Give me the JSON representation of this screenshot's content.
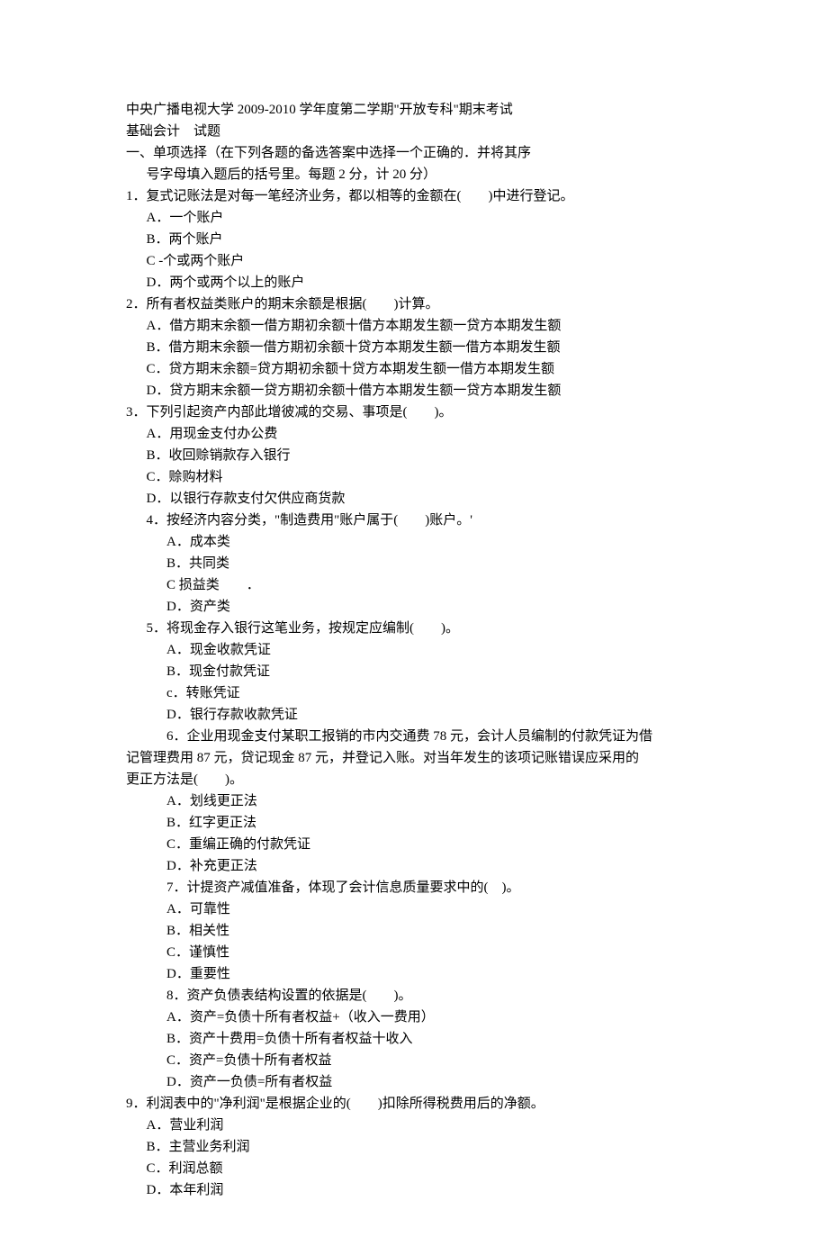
{
  "header": {
    "title_line1": "中央广播电视大学 2009-2010 学年度第二学期\"开放专科\"期末考试",
    "title_line2": "基础会计　试题"
  },
  "section1": {
    "heading_line1": "一、单项选择（在下列各题的备选答案中选择一个正确的．并将其序",
    "heading_line2": "号字母填入题后的括号里。每题 2 分，计 20 分）"
  },
  "q1": {
    "stem": "1．复式记账法是对每一笔经济业务，都以相等的金额在(　　)中进行登记。",
    "a": "A．一个账户",
    "b": "B．两个账户",
    "c": "C -个或两个账户",
    "d": "D．两个或两个以上的账户"
  },
  "q2": {
    "stem": "2．所有者权益类账户的期末余额是根据(　　)计算。",
    "a": "A．借方期末余额一借方期初余额十借方本期发生额一贷方本期发生额",
    "b": "B．借方期末余额一借方期初余额十贷方本期发生额一借方本期发生额",
    "c": "C．贷方期末余额=贷方期初余额十贷方本期发生额一借方本期发生额",
    "d": "D．贷方期末余额一贷方期初余额十借方本期发生额一贷方本期发生额"
  },
  "q3": {
    "stem": "3．下列引起资产内部此增彼减的交易、事项是(　　)。",
    "a": "A．用现金支付办公费",
    "b": "B．收回赊销款存入银行",
    "c": "C．赊购材料",
    "d": "D．以银行存款支付欠供应商货款"
  },
  "q4": {
    "stem": "4．按经济内容分类，\"制造费用\"账户属于(　　)账户。'",
    "a": "A．成本类",
    "b": "B．共同类",
    "c": "C 损益类　　．",
    "d": "D．资产类"
  },
  "q5": {
    "stem": "5．将现金存入银行这笔业务，按规定应编制(　　)。",
    "a": "A．现金收款凭证",
    "b": "B．现金付款凭证",
    "c": "c．转账凭证",
    "d": "D．银行存款收款凭证"
  },
  "q6": {
    "stem_line1": "6．企业用现金支付某职工报销的市内交通费 78 元，会计人员编制的付款凭证为借",
    "stem_line2": "记管理费用 87 元，贷记现金 87 元，并登记入账。对当年发生的该项记账错误应采用的",
    "stem_line3": "更正方法是(　　)。",
    "a": "A．划线更正法",
    "b": "B．红字更正法",
    "c": "C．重编正确的付款凭证",
    "d": "D．补充更正法"
  },
  "q7": {
    "stem": "7．计提资产减值准备，体现了会计信息质量要求中的(　)。",
    "a": "A．可靠性",
    "b": "B．相关性",
    "c": "C．谨慎性",
    "d": "D．重要性"
  },
  "q8": {
    "stem": "8．资产负债表结构设置的依据是(　　)。",
    "a": "A．资产=负债十所有者权益+（收入一费用）",
    "b": "B．资产十费用=负债十所有者权益十收入",
    "c": "C．资产=负债十所有者权益",
    "d": "D．资产一负债=所有者权益"
  },
  "q9": {
    "stem": "9．利润表中的\"净利润\"是根据企业的(　　)扣除所得税费用后的净额。",
    "a": "A．营业利润",
    "b": "B．主营业务利润",
    "c": "C．利润总额",
    "d": "D．本年利润"
  }
}
